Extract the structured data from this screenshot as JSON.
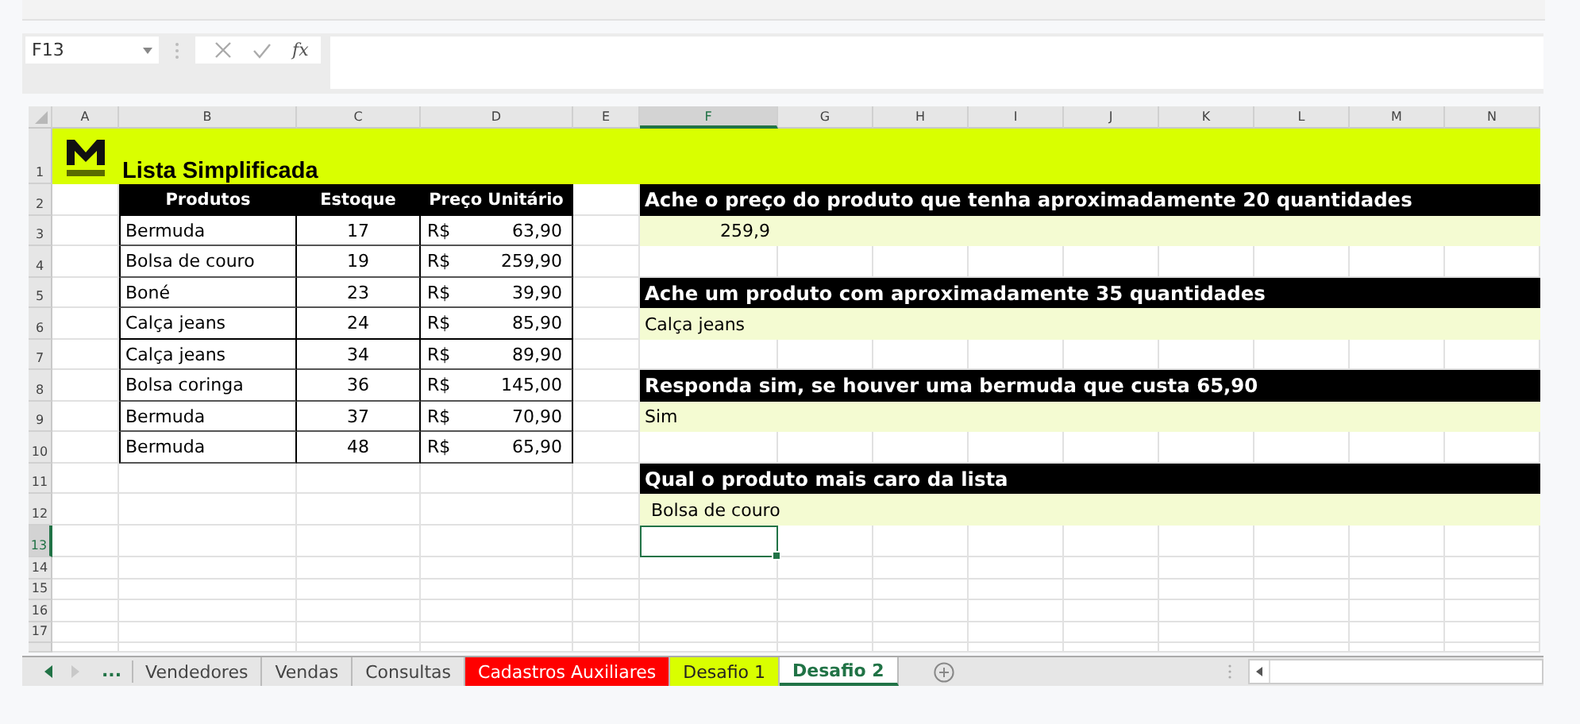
{
  "formula_bar": {
    "name_box": "F13",
    "function_label": "fx"
  },
  "columns": [
    {
      "label": "A",
      "selected": false
    },
    {
      "label": "B",
      "selected": false
    },
    {
      "label": "C",
      "selected": false
    },
    {
      "label": "D",
      "selected": false
    },
    {
      "label": "E",
      "selected": false
    },
    {
      "label": "F",
      "selected": true
    },
    {
      "label": "G",
      "selected": false
    },
    {
      "label": "H",
      "selected": false
    },
    {
      "label": "I",
      "selected": false
    },
    {
      "label": "J",
      "selected": false
    },
    {
      "label": "K",
      "selected": false
    },
    {
      "label": "L",
      "selected": false
    },
    {
      "label": "M",
      "selected": false
    },
    {
      "label": "N",
      "selected": false
    }
  ],
  "rows": [
    {
      "label": "1",
      "selected": false
    },
    {
      "label": "2",
      "selected": false
    },
    {
      "label": "3",
      "selected": false
    },
    {
      "label": "4",
      "selected": false
    },
    {
      "label": "5",
      "selected": false
    },
    {
      "label": "6",
      "selected": false
    },
    {
      "label": "7",
      "selected": false
    },
    {
      "label": "8",
      "selected": false
    },
    {
      "label": "9",
      "selected": false
    },
    {
      "label": "10",
      "selected": false
    },
    {
      "label": "11",
      "selected": false
    },
    {
      "label": "12",
      "selected": false
    },
    {
      "label": "13",
      "selected": true
    },
    {
      "label": "14",
      "selected": false
    },
    {
      "label": "15",
      "selected": false
    },
    {
      "label": "16",
      "selected": false
    },
    {
      "label": "17",
      "selected": false
    }
  ],
  "sheet_title": "Lista Simplificada",
  "table": {
    "columns": [
      "Produtos",
      "Estoque",
      "Preço Unitário"
    ],
    "rows": [
      {
        "product": "Bermuda",
        "stock": "17",
        "currency": "R$",
        "price": "63,90"
      },
      {
        "product": "Bolsa de couro",
        "stock": "19",
        "currency": "R$",
        "price": "259,90"
      },
      {
        "product": "Boné",
        "stock": "23",
        "currency": "R$",
        "price": "39,90"
      },
      {
        "product": "Calça jeans",
        "stock": "24",
        "currency": "R$",
        "price": "85,90"
      },
      {
        "product": "Calça jeans",
        "stock": "34",
        "currency": "R$",
        "price": "89,90"
      },
      {
        "product": "Bolsa coringa",
        "stock": "36",
        "currency": "R$",
        "price": "145,00"
      },
      {
        "product": "Bermuda",
        "stock": "37",
        "currency": "R$",
        "price": "70,90"
      },
      {
        "product": "Bermuda",
        "stock": "48",
        "currency": "R$",
        "price": "65,90"
      }
    ]
  },
  "questions": [
    {
      "question": "Ache o preço do produto que tenha aproximadamente 20 quantidades",
      "answer": "259,9",
      "kind": "number"
    },
    {
      "question": "Ache um produto com aproximadamente 35 quantidades",
      "answer": "Calça jeans",
      "kind": "text"
    },
    {
      "question": "Responda sim, se houver uma bermuda que custa 65,90",
      "answer": "Sim",
      "kind": "text"
    },
    {
      "question": "Qual o produto mais caro da lista",
      "answer": "Bolsa de couro",
      "kind": "indented"
    }
  ],
  "sheet_tabs": {
    "more": "...",
    "tabs": [
      {
        "label": "Vendedores",
        "selected": false
      },
      {
        "label": "Vendas",
        "selected": false
      },
      {
        "label": "Consultas",
        "selected": false
      },
      {
        "label": "Cadastros Auxiliares",
        "selected": false,
        "color": "#ff0000"
      },
      {
        "label": "Desafio 1",
        "selected": false,
        "color": "#d9ff00"
      },
      {
        "label": "Desafio 2",
        "selected": true
      }
    ]
  }
}
